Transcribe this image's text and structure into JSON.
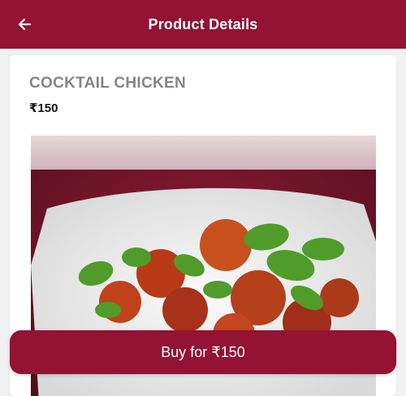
{
  "header": {
    "title": "Product Details",
    "back_icon": "arrow-left-icon",
    "background": "#941233"
  },
  "product": {
    "name": "COCKTAIL CHICKEN",
    "price": "₹150",
    "image_icon": "food-photo"
  },
  "footer": {
    "buy_label": "Buy for ₹150",
    "accent": "#941233"
  }
}
